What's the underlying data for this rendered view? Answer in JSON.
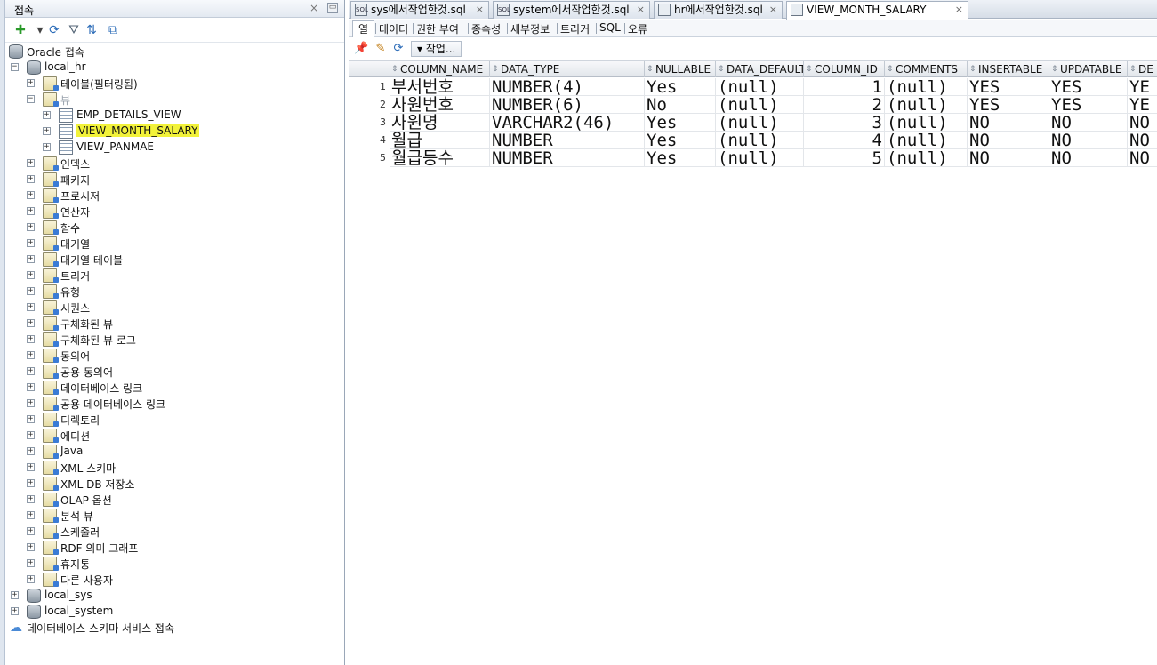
{
  "connections_panel": {
    "title": "접속",
    "close_label": "×",
    "minimize_label": "▭",
    "toolbar": [
      {
        "name": "add-connection-icon",
        "glyph": "✚",
        "color": "#2a9a2a"
      },
      {
        "name": "dropdown-arrow-icon",
        "glyph": "▾",
        "color": "#444444"
      },
      {
        "name": "refresh-icon",
        "glyph": "⟳",
        "color": "#2c6cb8"
      },
      {
        "name": "filter-icon",
        "glyph": "⛛",
        "color": "#556677"
      },
      {
        "name": "schema-browser-icon",
        "glyph": "⇅",
        "color": "#2c6cb8"
      },
      {
        "name": "collapse-all-icon",
        "glyph": "⧉",
        "color": "#2c6cb8"
      }
    ],
    "tree": [
      {
        "label": "Oracle 접속",
        "level": 0,
        "toggle": "",
        "icon": "db"
      },
      {
        "label": "local_hr",
        "level": 1,
        "toggle": "−",
        "icon": "db"
      },
      {
        "label": "테이블(필터링됨)",
        "level": 2,
        "toggle": "+",
        "icon": "folder"
      },
      {
        "label": "뷰",
        "level": 2,
        "toggle": "−",
        "icon": "folder",
        "muted": true
      },
      {
        "label": "EMP_DETAILS_VIEW",
        "level": 3,
        "toggle": "+",
        "icon": "view"
      },
      {
        "label": "VIEW_MONTH_SALARY",
        "level": 3,
        "toggle": "+",
        "icon": "view",
        "highlight": true
      },
      {
        "label": "VIEW_PANMAE",
        "level": 3,
        "toggle": "+",
        "icon": "view"
      },
      {
        "label": "인덱스",
        "level": 2,
        "toggle": "+",
        "icon": "folder"
      },
      {
        "label": "패키지",
        "level": 2,
        "toggle": "+",
        "icon": "folder"
      },
      {
        "label": "프로시저",
        "level": 2,
        "toggle": "+",
        "icon": "folder"
      },
      {
        "label": "연산자",
        "level": 2,
        "toggle": "+",
        "icon": "folder"
      },
      {
        "label": "함수",
        "level": 2,
        "toggle": "+",
        "icon": "folder"
      },
      {
        "label": "대기열",
        "level": 2,
        "toggle": "+",
        "icon": "folder"
      },
      {
        "label": "대기열 테이블",
        "level": 2,
        "toggle": "+",
        "icon": "folder"
      },
      {
        "label": "트리거",
        "level": 2,
        "toggle": "+",
        "icon": "folder"
      },
      {
        "label": "유형",
        "level": 2,
        "toggle": "+",
        "icon": "folder"
      },
      {
        "label": "시퀀스",
        "level": 2,
        "toggle": "+",
        "icon": "folder"
      },
      {
        "label": "구체화된 뷰",
        "level": 2,
        "toggle": "+",
        "icon": "folder"
      },
      {
        "label": "구체화된 뷰 로그",
        "level": 2,
        "toggle": "+",
        "icon": "folder"
      },
      {
        "label": "동의어",
        "level": 2,
        "toggle": "+",
        "icon": "folder"
      },
      {
        "label": "공용 동의어",
        "level": 2,
        "toggle": "+",
        "icon": "folder"
      },
      {
        "label": "데이터베이스 링크",
        "level": 2,
        "toggle": "+",
        "icon": "folder"
      },
      {
        "label": "공용 데이터베이스 링크",
        "level": 2,
        "toggle": "+",
        "icon": "folder"
      },
      {
        "label": "디렉토리",
        "level": 2,
        "toggle": "+",
        "icon": "folder"
      },
      {
        "label": "에디션",
        "level": 2,
        "toggle": "+",
        "icon": "folder"
      },
      {
        "label": "Java",
        "level": 2,
        "toggle": "+",
        "icon": "folder"
      },
      {
        "label": "XML 스키마",
        "level": 2,
        "toggle": "+",
        "icon": "folder"
      },
      {
        "label": "XML DB 저장소",
        "level": 2,
        "toggle": "+",
        "icon": "folder"
      },
      {
        "label": "OLAP 옵션",
        "level": 2,
        "toggle": "+",
        "icon": "folder"
      },
      {
        "label": "분석 뷰",
        "level": 2,
        "toggle": "+",
        "icon": "folder"
      },
      {
        "label": "스케줄러",
        "level": 2,
        "toggle": "+",
        "icon": "folder"
      },
      {
        "label": "RDF 의미 그래프",
        "level": 2,
        "toggle": "+",
        "icon": "folder"
      },
      {
        "label": "휴지통",
        "level": 2,
        "toggle": "+",
        "icon": "folder"
      },
      {
        "label": "다른 사용자",
        "level": 2,
        "toggle": "+",
        "icon": "folder"
      },
      {
        "label": "local_sys",
        "level": 1,
        "toggle": "+",
        "icon": "db"
      },
      {
        "label": "local_system",
        "level": 1,
        "toggle": "+",
        "icon": "db"
      },
      {
        "label": "데이터베이스 스키마 서비스 접속",
        "level": 0,
        "toggle": "",
        "icon": "cloud"
      }
    ]
  },
  "editor": {
    "tabs": [
      {
        "label": "sys에서작업한것.sql",
        "icon_text": "SQL",
        "close": "×",
        "active": false
      },
      {
        "label": "system에서작업한것.sql",
        "icon_text": "SQL",
        "close": "×",
        "active": false
      },
      {
        "label": "hr에서작업한것.sql",
        "icon_text": "",
        "close": "×",
        "active": false
      },
      {
        "label": "VIEW_MONTH_SALARY",
        "icon_text": "",
        "close": "×",
        "active": true
      }
    ],
    "subtabs": [
      "열",
      "데이터",
      "권한 부여",
      "종속성",
      "세부정보",
      "트리거",
      "SQL",
      "오류"
    ],
    "actions_label": "▾ 작업...",
    "grid": {
      "columns": [
        "COLUMN_NAME",
        "DATA_TYPE",
        "NULLABLE",
        "DATA_DEFAULT",
        "COLUMN_ID",
        "COMMENTS",
        "INSERTABLE",
        "UPDATABLE",
        "DE"
      ],
      "rows": [
        {
          "n": "1",
          "cells": [
            "부서번호",
            "NUMBER(4)",
            "Yes",
            "(null)",
            "1",
            "(null)",
            "YES",
            "YES",
            "YE"
          ]
        },
        {
          "n": "2",
          "cells": [
            "사원번호",
            "NUMBER(6)",
            "No",
            "(null)",
            "2",
            "(null)",
            "YES",
            "YES",
            "YE"
          ]
        },
        {
          "n": "3",
          "cells": [
            "사원명",
            "VARCHAR2(46)",
            "Yes",
            "(null)",
            "3",
            "(null)",
            "NO",
            "NO",
            "NO"
          ]
        },
        {
          "n": "4",
          "cells": [
            "월급",
            "NUMBER",
            "Yes",
            "(null)",
            "4",
            "(null)",
            "NO",
            "NO",
            "NO"
          ]
        },
        {
          "n": "5",
          "cells": [
            "월급등수",
            "NUMBER",
            "Yes",
            "(null)",
            "5",
            "(null)",
            "NO",
            "NO",
            "NO"
          ]
        }
      ]
    }
  }
}
